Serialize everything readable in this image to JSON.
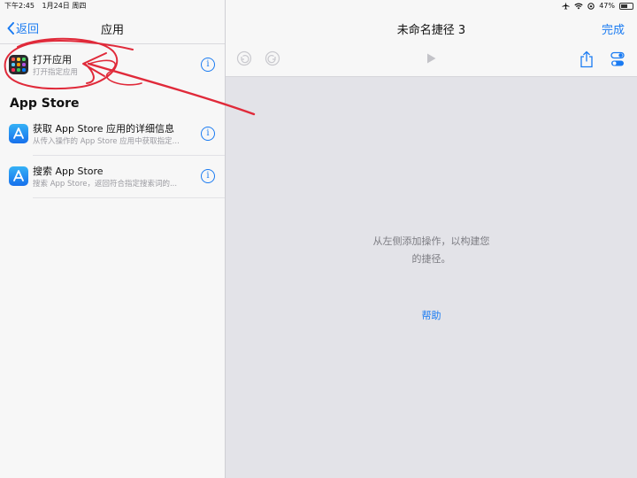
{
  "status_bar": {
    "time": "下午2:45",
    "date": "1月24日 周四",
    "battery": "47%",
    "battery_level": 0.47
  },
  "left": {
    "back_label": "返回",
    "title": "应用",
    "items": [
      {
        "title": "打开应用",
        "subtitle": "打开指定应用",
        "icon": "app-grid-icon"
      }
    ],
    "section_title": "App Store",
    "section_items": [
      {
        "title": "获取 App Store 应用的详细信息",
        "subtitle": "从传入操作的 App Store 应用中获取指定...",
        "icon": "app-store-icon"
      },
      {
        "title": "搜索 App Store",
        "subtitle": "搜索 App Store，返回符合指定搜索词的...",
        "icon": "app-store-icon"
      }
    ]
  },
  "right": {
    "title": "未命名捷径 3",
    "done_label": "完成",
    "empty_line1": "从左侧添加操作，以构建您",
    "empty_line2": "的捷径。",
    "help_label": "帮助"
  },
  "colors": {
    "accent": "#1a7bf2",
    "annotation": "#e02a3a"
  }
}
